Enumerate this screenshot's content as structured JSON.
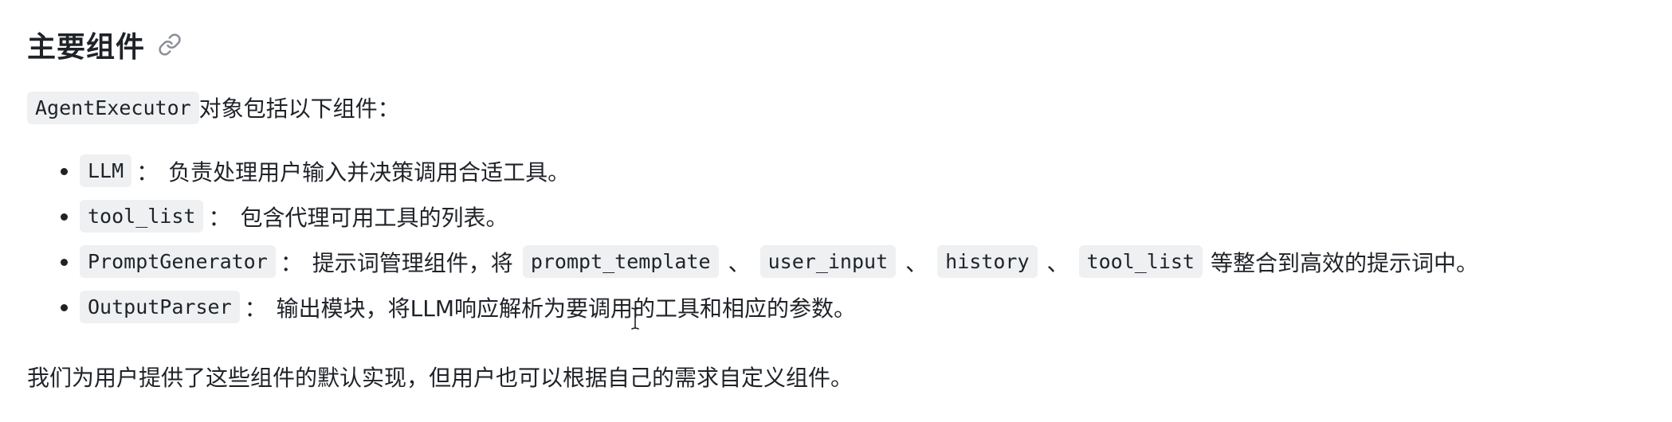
{
  "section": {
    "heading": "主要组件",
    "anchor_icon": "link-icon"
  },
  "intro": {
    "code": "AgentExecutor",
    "text": "对象包括以下组件："
  },
  "items": [
    {
      "code": "LLM",
      "colon": "：",
      "text": "负责处理用户输入并决策调用合适工具。"
    },
    {
      "code": "tool_list",
      "colon": "：",
      "text": "包含代理可用工具的列表。"
    },
    {
      "code": "PromptGenerator",
      "colon": "：",
      "text_before": "提示词管理组件，将",
      "codes": [
        "prompt_template",
        "user_input",
        "history",
        "tool_list"
      ],
      "separator": "、",
      "text_after": "等整合到高效的提示词中。"
    },
    {
      "code": "OutputParser",
      "colon": "：",
      "text": "输出模块，将LLM响应解析为要调用的工具和相应的参数。"
    }
  ],
  "outro": {
    "text": "我们为用户提供了这些组件的默认实现，但用户也可以根据自己的需求自定义组件。"
  },
  "cursor": {
    "icon": "text-cursor-icon"
  }
}
